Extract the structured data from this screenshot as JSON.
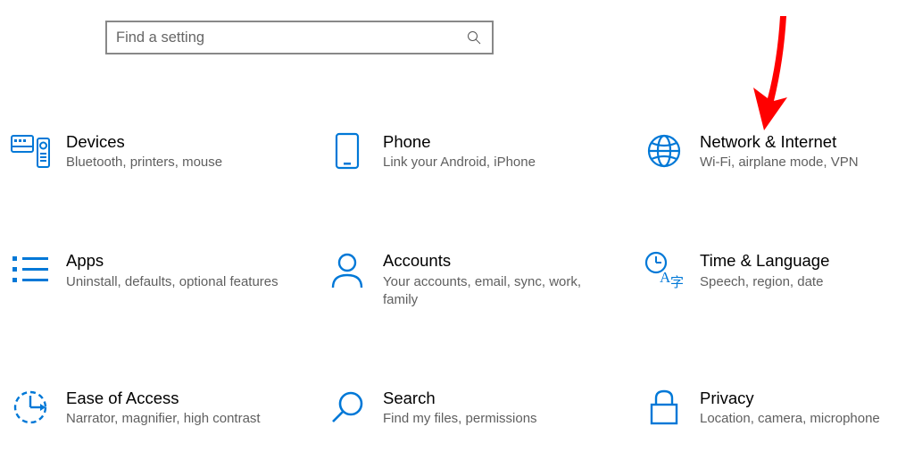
{
  "search": {
    "placeholder": "Find a setting"
  },
  "accent": "#0078d7",
  "tiles": [
    {
      "title": "Devices",
      "desc": "Bluetooth, printers, mouse"
    },
    {
      "title": "Phone",
      "desc": "Link your Android, iPhone"
    },
    {
      "title": "Network & Internet",
      "desc": "Wi-Fi, airplane mode, VPN"
    },
    {
      "title": "Apps",
      "desc": "Uninstall, defaults, optional features"
    },
    {
      "title": "Accounts",
      "desc": "Your accounts, email, sync, work, family"
    },
    {
      "title": "Time & Language",
      "desc": "Speech, region, date"
    },
    {
      "title": "Ease of Access",
      "desc": "Narrator, magnifier, high contrast"
    },
    {
      "title": "Search",
      "desc": "Find my files, permissions"
    },
    {
      "title": "Privacy",
      "desc": "Location, camera, microphone"
    }
  ],
  "annotation": {
    "type": "arrow",
    "points_to": "Network & Internet",
    "color": "#ff0000"
  }
}
